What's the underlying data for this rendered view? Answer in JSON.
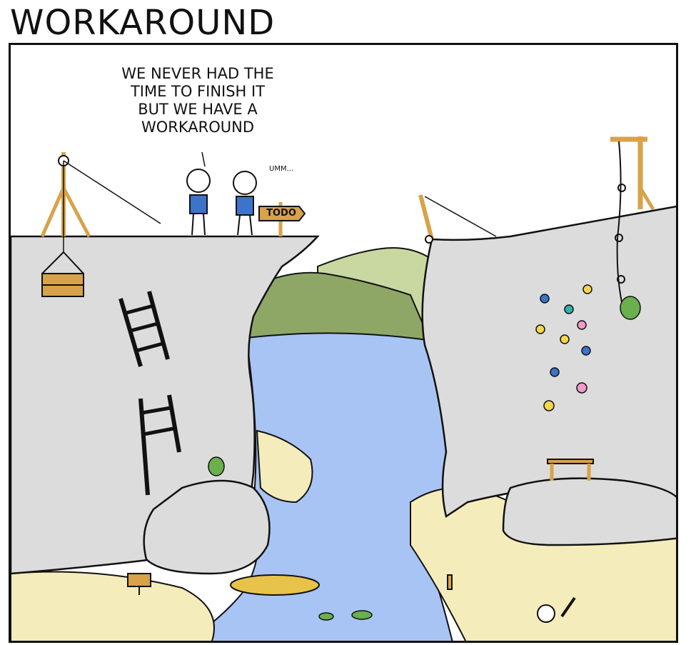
{
  "comic": {
    "title": "WORKAROUND",
    "speech": "WE NEVER HAD THE\nTIME TO FINISH IT\nBUT WE HAVE A\nWORKAROUND",
    "reply": "UMM...",
    "sign": "TODO"
  },
  "colors": {
    "cliff": "#dcdcdc",
    "water": "#a8c4f4",
    "sand": "#f5ecbb",
    "hill_dark": "#8ea766",
    "hill_light": "#c8d8a0",
    "wood": "#d8a24a",
    "creature": "#6ab04c",
    "shirt": "#3b74c9"
  },
  "icons": [
    "crane-icon",
    "ladder-icon",
    "boat-icon",
    "skull-icon",
    "crocodile-icon",
    "climbing-hold-icon",
    "rope-icon"
  ]
}
